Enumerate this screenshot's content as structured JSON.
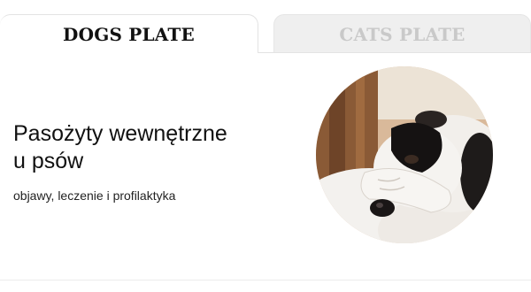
{
  "tabs": [
    {
      "label": "DOGS PLATE",
      "active": true
    },
    {
      "label": "CATS PLATE",
      "active": false
    }
  ],
  "article": {
    "title_line1": "Pasożyty wewnętrzne",
    "title_line2": "u psów",
    "subtitle": "objawy, leczenie i profilaktyka"
  },
  "colors": {
    "active_tab_text": "#111111",
    "inactive_tab_text": "#c9c9c9",
    "inactive_tab_bg": "#efefef"
  }
}
